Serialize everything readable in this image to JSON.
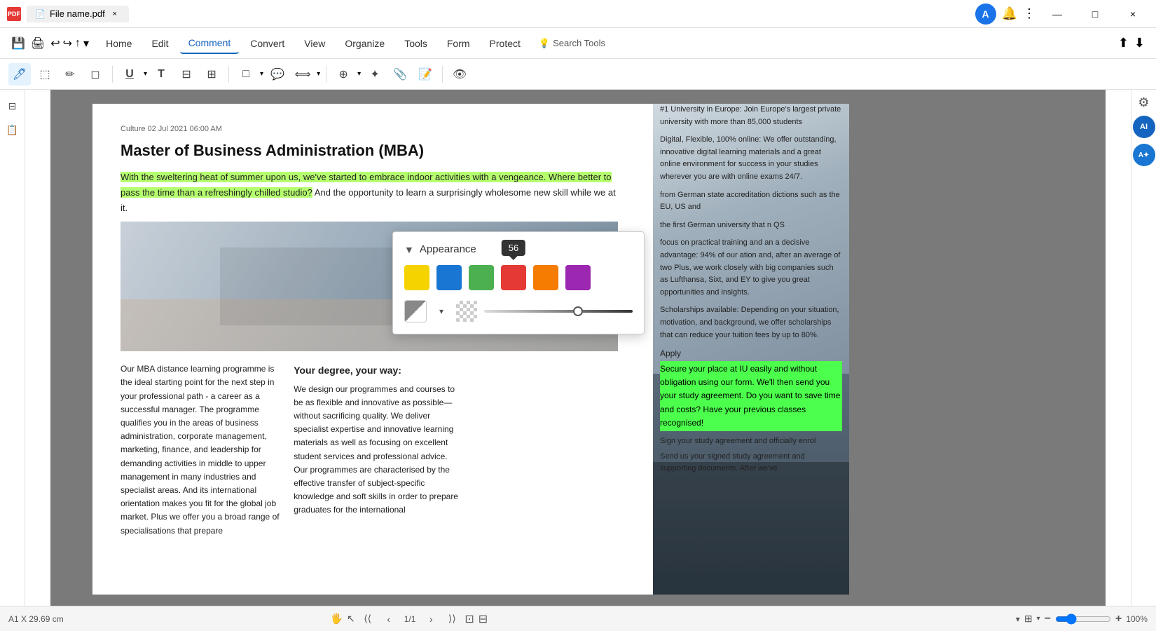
{
  "titlebar": {
    "tab_title": "File name.pdf",
    "close_label": "×",
    "minimize_label": "—",
    "maximize_label": "□"
  },
  "menubar": {
    "items": [
      {
        "id": "home",
        "label": "Home",
        "active": false
      },
      {
        "id": "edit",
        "label": "Edit",
        "active": false
      },
      {
        "id": "comment",
        "label": "Comment",
        "active": true
      },
      {
        "id": "convert",
        "label": "Convert",
        "active": false
      },
      {
        "id": "view",
        "label": "View",
        "active": false
      },
      {
        "id": "organize",
        "label": "Organize",
        "active": false
      },
      {
        "id": "tools",
        "label": "Tools",
        "active": false
      },
      {
        "id": "form",
        "label": "Form",
        "active": false
      },
      {
        "id": "protect",
        "label": "Protect",
        "active": false
      }
    ],
    "search_placeholder": "Search Tools"
  },
  "appearance_popup": {
    "title": "Appearance",
    "colors": [
      {
        "id": "yellow",
        "hex": "#f5d300"
      },
      {
        "id": "blue",
        "hex": "#1976d2"
      },
      {
        "id": "green",
        "hex": "#4caf50"
      },
      {
        "id": "red",
        "hex": "#e53935"
      },
      {
        "id": "orange",
        "hex": "#f57c00"
      },
      {
        "id": "purple",
        "hex": "#9c27b0"
      }
    ],
    "opacity_tooltip": "56",
    "opacity_value": 56
  },
  "document": {
    "header": "Culture 02 Jul 2021 06:00 AM",
    "title": "Master of Business Administration (MBA)",
    "highlighted_paragraph": "With the sweltering heat of summer upon us, we've started to embrace indoor activities with a vengeance. Where better to pass the time than a refreshingly chilled studio?",
    "normal_paragraph": " And the opportunity to learn a surprisingly wholesome new skill while we at it.",
    "right_col_1": "#1 University in Europe: Join Europe's largest private university with more than 85,000 students",
    "right_col_2": "Digital, Flexible, 100% online: We offer outstanding, innovative digital learning materials and a great online environment for success in your studies wherever you are with online exams 24/7.",
    "right_col_3": "from German state accreditation dictions such as the EU, US and",
    "right_col_4": "the first German university that n QS",
    "right_col_5": "focus on practical training and an a decisive advantage: 94% of our ation and, after an average of two Plus, we work closely with big companies such as Lufthansa, Sixt, and EY to give you great opportunities and insights.",
    "right_col_6": "Scholarships available: Depending on your situation, motivation, and background, we offer scholarships that can reduce your tuition fees by up to 80%.",
    "apply_title": "Apply",
    "apply_green_text": "Secure your place at IU easily and without obligation using our form. We'll then send you your study agreement. Do you want to save time and costs? Have your previous classes recognised!",
    "sign_text": "Sign your study agreement and officially enrol",
    "send_text": "Send us your signed study agreement and supporting documents. After we've",
    "lower_left": "Our MBA distance learning programme is the ideal starting point for the next step in your professional path - a career as a successful manager. The programme qualifies you in the areas of business administration, corporate management, marketing, finance, and leadership for demanding activities in middle to upper management in many industries and specialist areas. And its international orientation makes you fit for the global job market. Plus we offer you a broad range of specialisations that prepare",
    "your_degree_title": "Your degree, your way:",
    "your_degree_text": "We design our programmes and courses to be as flexible and innovative as possible—without sacrificing quality. We deliver specialist expertise and innovative learning materials as well as focusing on excellent student services and professional advice. Our programmes are characterised by the effective transfer of subject-specific knowledge and soft skills in order to prepare graduates for the international",
    "page_num": "1/1",
    "page_size": "A1 X 29.69 cm",
    "zoom": "100%"
  },
  "bottom_bar": {
    "page_size": "A1 X 29.69 cm",
    "page_nav": "1/1",
    "zoom_percent": "100%",
    "fit_label": "Fit"
  },
  "toolbar_icons": {
    "highlight": "✏",
    "area": "⬚",
    "pencil": "✒",
    "eraser": "◻",
    "underline": "U",
    "textbox": "T",
    "callout": "⊟",
    "table": "⊞",
    "rect": "□",
    "bubble": "💬",
    "measure": "⟺",
    "stamp": "⊕",
    "signature": "✦",
    "attach": "📎",
    "note": "📝",
    "eye": "👁"
  }
}
